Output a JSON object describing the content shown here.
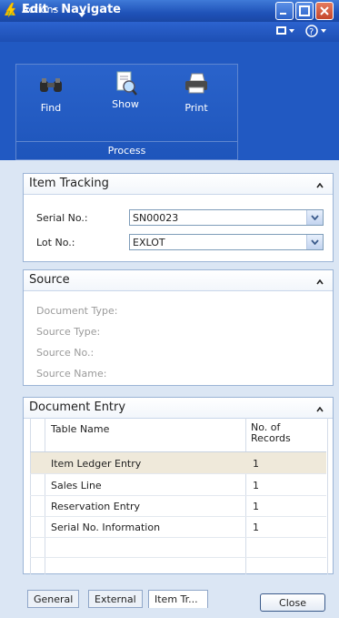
{
  "window": {
    "title": "Edit - Navigate",
    "app_icon": "dynamics-nav-icon",
    "controls": [
      "minimize-icon",
      "maximize-icon",
      "close-icon"
    ]
  },
  "actions_bar": {
    "label": "Actions",
    "icons": [
      "bolt-icon",
      "chevron-down-icon",
      "layout-icon",
      "help-icon"
    ]
  },
  "ribbon": {
    "group_label": "Process",
    "buttons": [
      {
        "label": "Find",
        "icon": "binoculars-icon"
      },
      {
        "label": "Show",
        "icon": "document-magnifier-icon"
      },
      {
        "label": "Print",
        "icon": "printer-icon"
      }
    ]
  },
  "item_tracking": {
    "title": "Item Tracking",
    "serial_label": "Serial No.:",
    "serial_value": "SN00023",
    "lot_label": "Lot No.:",
    "lot_value": "EXLOT"
  },
  "source": {
    "title": "Source",
    "fields": [
      "Document Type:",
      "Source Type:",
      "Source No.:",
      "Source Name:"
    ]
  },
  "document_entry": {
    "title": "Document Entry",
    "columns": [
      "Table Name",
      "No. of Records"
    ],
    "rows": [
      {
        "table": "Item Ledger Entry",
        "records": "1"
      },
      {
        "table": "Sales Line",
        "records": "1"
      },
      {
        "table": "Reservation Entry",
        "records": "1"
      },
      {
        "table": "Serial No. Information",
        "records": "1"
      }
    ]
  },
  "tabs": [
    "General",
    "External",
    "Item Tr..."
  ],
  "close_label": "Close",
  "colors": {
    "title_bar": "#1f52b8",
    "ribbon": "#2159c2",
    "selected_row": "#efe9da",
    "background": "#dbe6f4"
  }
}
